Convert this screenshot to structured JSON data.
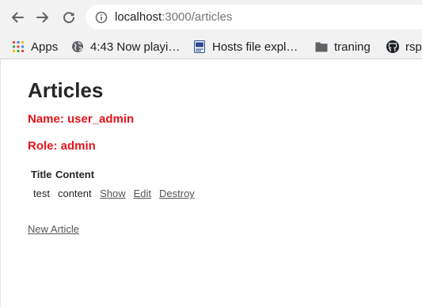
{
  "browser": {
    "url": {
      "host": "localhost",
      "rest": ":3000/articles"
    },
    "bookmarks": [
      {
        "label": "Apps",
        "icon": "apps-grid-icon"
      },
      {
        "label": "4:43 Now playi…",
        "icon": "globe-icon"
      },
      {
        "label": "Hosts file expl…",
        "icon": "site-favicon-icon"
      },
      {
        "label": "traning",
        "icon": "folder-icon"
      },
      {
        "label": "rsp",
        "icon": "github-icon"
      }
    ]
  },
  "page": {
    "title": "Articles",
    "name_line": "Name: user_admin",
    "role_line": "Role: admin",
    "table": {
      "headers": [
        "Title",
        "Content"
      ],
      "rows": [
        {
          "title": "test",
          "content": "content",
          "show": "Show",
          "edit": "Edit",
          "destroy": "Destroy"
        }
      ]
    },
    "new_link": "New Article"
  },
  "colors": {
    "meta_red": "#e8131b",
    "link_gray": "#555555",
    "toolbar_bg": "#f2f2f2"
  }
}
